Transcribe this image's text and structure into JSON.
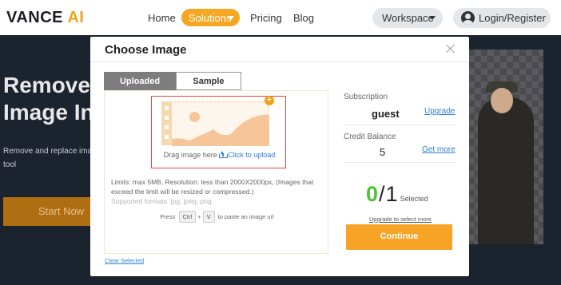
{
  "nav": {
    "logo_main": "VANCE",
    "logo_ai": "AI",
    "home": "Home",
    "solutions": "Solutions",
    "pricing": "Pricing",
    "blog": "Blog",
    "workspace": "Workspace",
    "login": "Login/Register"
  },
  "hero": {
    "title_line1": "Remove",
    "title_line2": "Image In",
    "sub_line1": "Remove and replace imag",
    "sub_line2": "tool",
    "start_button": "Start Now"
  },
  "modal": {
    "title": "Choose Image",
    "tabs": [
      {
        "label": "Uploaded",
        "active": true
      },
      {
        "label": "Sample",
        "active": false
      }
    ],
    "dropzone": {
      "text": "Drag image here",
      "upload_link": "Click to upload"
    },
    "limits": "Limits: max 5MB,  Resolution: less than 2000X2000px,  (Images that exceed the limit will be resized or compressed.)",
    "formats": "Supported formats: jpg, jpeg, png",
    "paste": {
      "prefix": "Press",
      "key1": "Ctrl",
      "plus": "+",
      "key2": "V",
      "suffix": "to paste an image url"
    },
    "clear_selected": "Clear Selected",
    "subscription": {
      "label": "Subscription",
      "value": "guest",
      "link": "Upgrade"
    },
    "credit": {
      "label": "Credit Balance",
      "value": "5",
      "link": "Get more"
    },
    "selection": {
      "selected_count": "0",
      "slash": "/",
      "total": "1",
      "label": "Selected"
    },
    "upgrade_select": "Upgrade to select more",
    "continue_button": "Continue"
  },
  "colors": {
    "accent": "#f7a325",
    "link": "#2f7fd6",
    "selected_count": "#4fc23a",
    "dropzone_border": "#e8433b"
  }
}
